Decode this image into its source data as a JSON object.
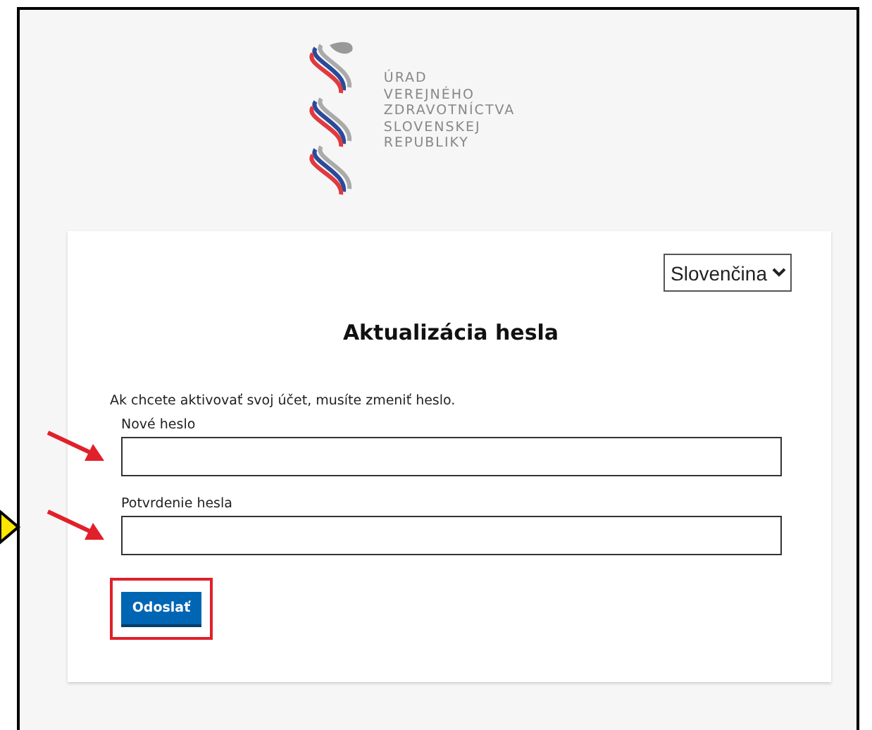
{
  "logo": {
    "lines": [
      "ÚRAD",
      "VEREJNÉHO",
      "ZDRAVOTNÍCTVA",
      "SLOVENSKEJ",
      "REPUBLIKY"
    ]
  },
  "language_select": {
    "value": "Slovenčina"
  },
  "form": {
    "title": "Aktualizácia hesla",
    "message": "Ak chcete aktivovať svoj účet, musíte zmeniť heslo.",
    "fields": [
      {
        "label": "Nové heslo"
      },
      {
        "label": "Potvrdenie hesla"
      }
    ],
    "submit": "Odoslať"
  }
}
